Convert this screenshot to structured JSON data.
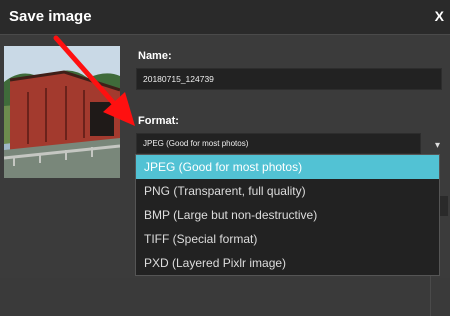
{
  "dialog": {
    "title": "Save image",
    "close_label": "X"
  },
  "name_section": {
    "label": "Name:",
    "value": "20180715_124739"
  },
  "format_section": {
    "label": "Format:",
    "selected": "JPEG (Good for most photos)",
    "options": [
      "JPEG (Good for most photos)",
      "PNG (Transparent, full quality)",
      "BMP (Large but non-destructive)",
      "TIFF (Special format)",
      "PXD (Layered Pixlr image)"
    ]
  },
  "colors": {
    "accent_selected": "#52c2d4",
    "annotation_arrow": "#ff1010"
  },
  "icons": {
    "dropdown": "chevron-down-icon",
    "annotation": "red-arrow-icon"
  }
}
